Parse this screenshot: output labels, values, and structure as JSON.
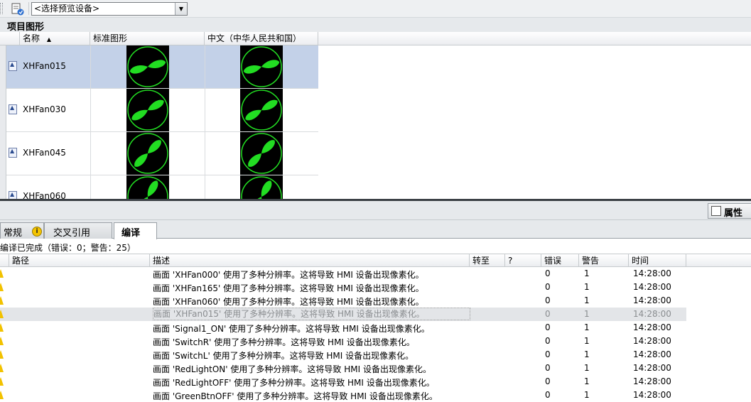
{
  "toolbar": {
    "device_select_value": "<选择预览设备>"
  },
  "section": {
    "title": "项目图形"
  },
  "graphics_table": {
    "columns": [
      "名称",
      "标准图形",
      "中文（中华人民共和国）"
    ],
    "sort_indicator": "▲",
    "rows": [
      {
        "name": "XHFan015",
        "selected": true,
        "angle": 15
      },
      {
        "name": "XHFan030",
        "selected": false,
        "angle": 30
      },
      {
        "name": "XHFan045",
        "selected": false,
        "angle": 45
      },
      {
        "name": "XHFan060",
        "selected": false,
        "angle": 60
      }
    ]
  },
  "properties_button": {
    "label": "属性"
  },
  "tabs": [
    {
      "label": "常规",
      "info_icon": "i"
    },
    {
      "label": "交叉引用"
    },
    {
      "label": "编译",
      "active": true
    }
  ],
  "compile_status": "编译已完成（错误：0；警告：25）",
  "messages_table": {
    "columns": [
      "路径",
      "描述",
      "转至",
      "?",
      "错误",
      "警告",
      "时间"
    ],
    "rows": [
      {
        "desc": "画面 'XHFan000' 使用了多种分辨率。这将导致 HMI 设备出现像素化。",
        "errors": "0",
        "warnings": "1",
        "time": "14:28:00",
        "dim": false
      },
      {
        "desc": "画面 'XHFan165' 使用了多种分辨率。这将导致 HMI 设备出现像素化。",
        "errors": "0",
        "warnings": "1",
        "time": "14:28:00",
        "dim": false
      },
      {
        "desc": "画面 'XHFan060' 使用了多种分辨率。这将导致 HMI 设备出现像素化。",
        "errors": "0",
        "warnings": "1",
        "time": "14:28:00",
        "dim": false
      },
      {
        "desc": "画面 'XHFan015' 使用了多种分辨率。这将导致 HMI 设备出现像素化。",
        "errors": "0",
        "warnings": "1",
        "time": "14:28:00",
        "dim": true
      },
      {
        "desc": "画面 'Signal1_ON' 使用了多种分辨率。这将导致 HMI 设备出现像素化。",
        "errors": "0",
        "warnings": "1",
        "time": "14:28:00",
        "dim": false
      },
      {
        "desc": "画面 'SwitchR' 使用了多种分辨率。这将导致 HMI 设备出现像素化。",
        "errors": "0",
        "warnings": "1",
        "time": "14:28:00",
        "dim": false
      },
      {
        "desc": "画面 'SwitchL' 使用了多种分辨率。这将导致 HMI 设备出现像素化。",
        "errors": "0",
        "warnings": "1",
        "time": "14:28:00",
        "dim": false
      },
      {
        "desc": "画面 'RedLightON' 使用了多种分辨率。这将导致 HMI 设备出现像素化。",
        "errors": "0",
        "warnings": "1",
        "time": "14:28:00",
        "dim": false
      },
      {
        "desc": "画面 'RedLightOFF' 使用了多种分辨率。这将导致 HMI 设备出现像素化。",
        "errors": "0",
        "warnings": "1",
        "time": "14:28:00",
        "dim": false
      },
      {
        "desc": "画面 'GreenBtnOFF' 使用了多种分辨率。这将导致 HMI 设备出现像素化。",
        "errors": "0",
        "warnings": "1",
        "time": "14:28:00",
        "dim": false
      }
    ]
  },
  "colors": {
    "selection": "#c3d1e8",
    "fan_green": "#22dd22",
    "warning_yellow": "#f2c200"
  }
}
